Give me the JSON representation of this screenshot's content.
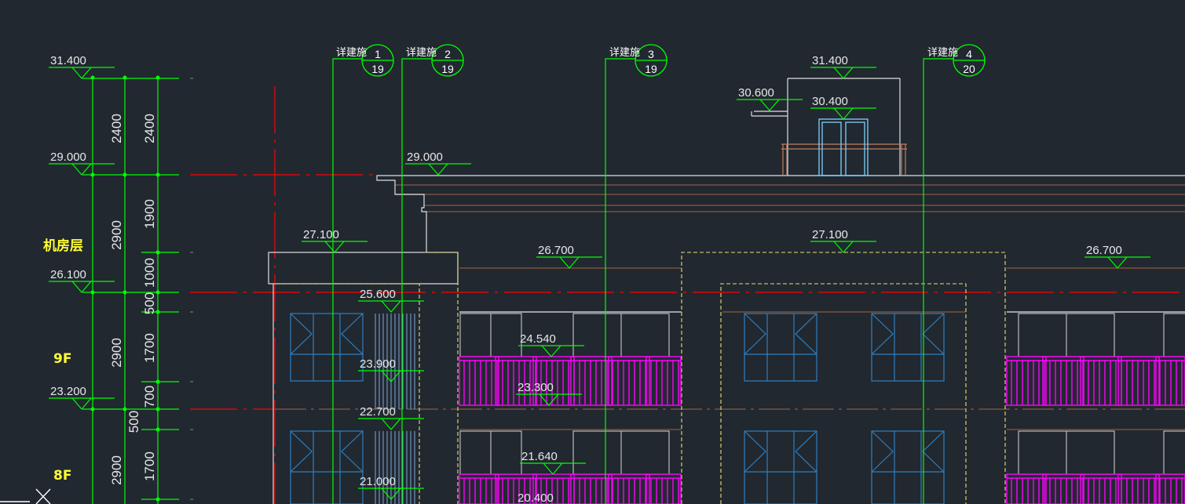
{
  "elevations_left": [
    {
      "id": "el-31400",
      "label": "31.400"
    },
    {
      "id": "el-29000",
      "label": "29.000"
    },
    {
      "id": "el-26100",
      "label": "26.100"
    },
    {
      "id": "el-23200",
      "label": "23.200"
    }
  ],
  "elevations_main": [
    {
      "id": "el-29000-roof",
      "label": "29.000"
    },
    {
      "id": "el-31400-top",
      "label": "31.400"
    },
    {
      "id": "el-30600",
      "label": "30.600"
    },
    {
      "id": "el-30400",
      "label": "30.400"
    },
    {
      "id": "el-27100-a",
      "label": "27.100"
    },
    {
      "id": "el-27100-b",
      "label": "27.100"
    },
    {
      "id": "el-26700-a",
      "label": "26.700"
    },
    {
      "id": "el-26700-b",
      "label": "26.700"
    },
    {
      "id": "el-25600",
      "label": "25.600"
    },
    {
      "id": "el-24540",
      "label": "24.540"
    },
    {
      "id": "el-23900",
      "label": "23.900"
    },
    {
      "id": "el-23300",
      "label": "23.300"
    },
    {
      "id": "el-22700",
      "label": "22.700"
    },
    {
      "id": "el-21640",
      "label": "21.640"
    },
    {
      "id": "el-21000",
      "label": "21.000"
    },
    {
      "id": "el-20400",
      "label": "20.400"
    }
  ],
  "dims_outer": [
    "2400",
    "2900",
    "2900",
    "2900"
  ],
  "dims_inner": [
    "2400",
    "1900",
    "1000",
    "500",
    "1700",
    "700",
    "1700"
  ],
  "dim_small": "500",
  "floor_labels": [
    "机房层",
    "9F",
    "8F"
  ],
  "detail_callouts": [
    {
      "id": "callout-1",
      "text": "详建施",
      "num": "1",
      "sheet": "19"
    },
    {
      "id": "callout-2",
      "text": "详建施",
      "num": "2",
      "sheet": "19"
    },
    {
      "id": "callout-3",
      "text": "详建施",
      "num": "3",
      "sheet": "19"
    },
    {
      "id": "callout-4",
      "text": "详建施",
      "num": "4",
      "sheet": "20"
    }
  ],
  "colors": {
    "background": "#212830",
    "dimension": "#00ff00",
    "railing": "#ff00ff",
    "window": "#2f7fbf",
    "axis": "#ff0000",
    "outline": "#ffffff",
    "dashed": "#e8e070",
    "brown": "#8b5a3c",
    "floor_text": "#ffff33"
  }
}
